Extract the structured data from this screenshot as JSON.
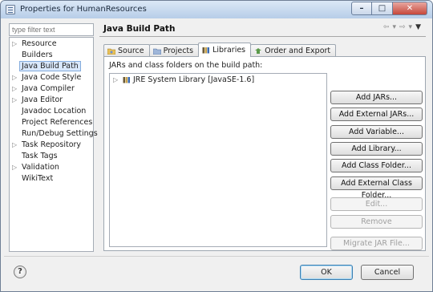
{
  "window": {
    "title": "Properties for HumanResources"
  },
  "filter": {
    "placeholder": "type filter text"
  },
  "sidebar": {
    "items": [
      {
        "label": "Resource",
        "expandable": true
      },
      {
        "label": "Builders",
        "expandable": false
      },
      {
        "label": "Java Build Path",
        "expandable": false,
        "selected": true
      },
      {
        "label": "Java Code Style",
        "expandable": true
      },
      {
        "label": "Java Compiler",
        "expandable": true
      },
      {
        "label": "Java Editor",
        "expandable": true
      },
      {
        "label": "Javadoc Location",
        "expandable": false
      },
      {
        "label": "Project References",
        "expandable": false
      },
      {
        "label": "Run/Debug Settings",
        "expandable": false
      },
      {
        "label": "Task Repository",
        "expandable": true
      },
      {
        "label": "Task Tags",
        "expandable": false
      },
      {
        "label": "Validation",
        "expandable": true
      },
      {
        "label": "WikiText",
        "expandable": false
      }
    ]
  },
  "page": {
    "title": "Java Build Path"
  },
  "tabs": [
    {
      "label": "Source",
      "icon": "source-folder-icon"
    },
    {
      "label": "Projects",
      "icon": "projects-icon"
    },
    {
      "label": "Libraries",
      "icon": "libraries-icon",
      "active": true
    },
    {
      "label": "Order and Export",
      "icon": "order-export-icon"
    }
  ],
  "libraries": {
    "heading": "JARs and class folders on the build path:",
    "entries": [
      {
        "label": "JRE System Library [JavaSE-1.6]"
      }
    ]
  },
  "buttons": {
    "add_jars": "Add JARs...",
    "add_external_jars": "Add External JARs...",
    "add_variable": "Add Variable...",
    "add_library": "Add Library...",
    "add_class_folder": "Add Class Folder...",
    "add_external_class_folder": "Add External Class Folder...",
    "edit": "Edit...",
    "remove": "Remove",
    "migrate_jar": "Migrate JAR File..."
  },
  "dialog": {
    "ok": "OK",
    "cancel": "Cancel",
    "help": "?"
  },
  "colors": {
    "selection": "#d9e8fb",
    "close_button": "#c6473a",
    "title_bar": "#b7cde8"
  }
}
